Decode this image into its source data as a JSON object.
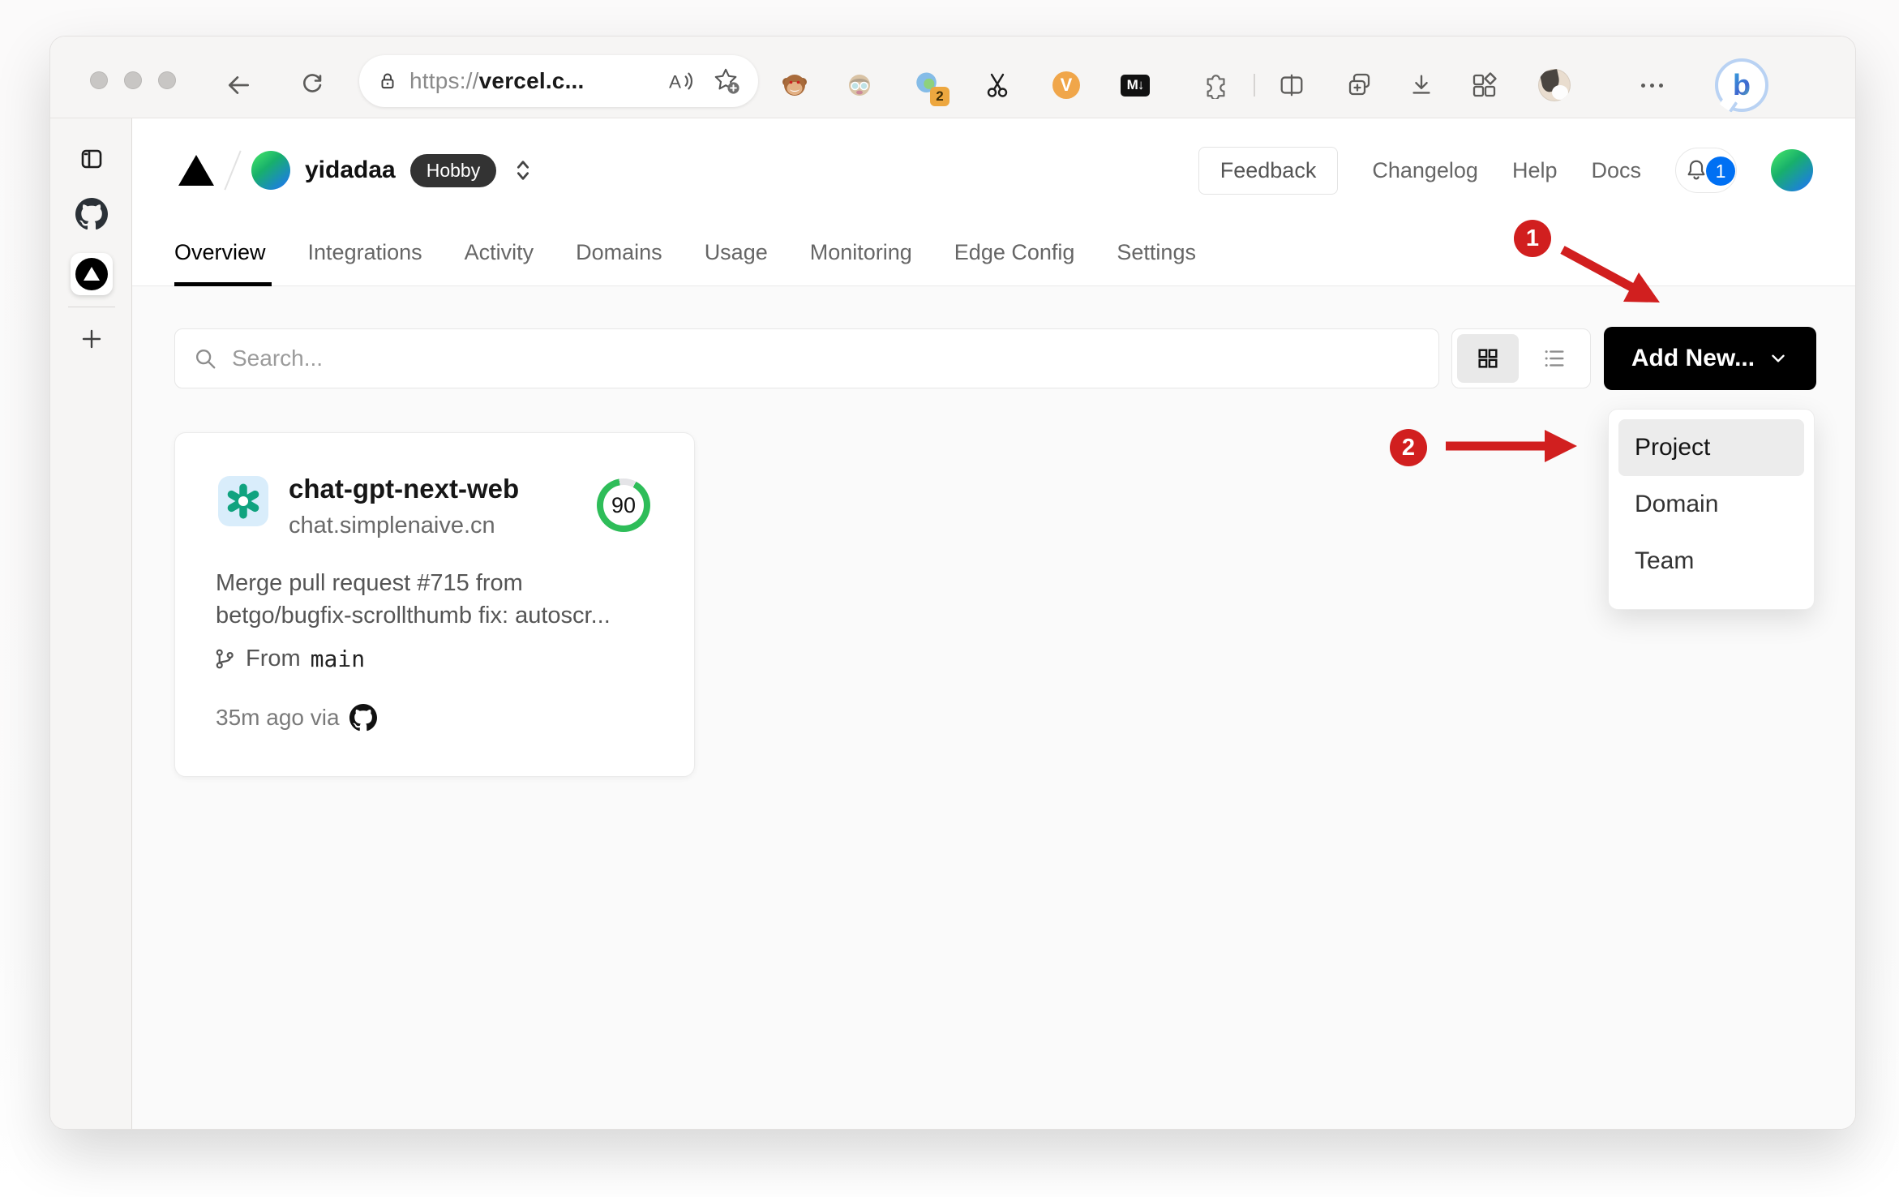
{
  "browser": {
    "url": {
      "scheme": "https://",
      "host": "vercel.c..."
    },
    "extensions_badge": "2",
    "markdown_glyph": "M↓",
    "video_glyph": "V",
    "copilot_glyph": "b"
  },
  "icons": {
    "search": "magnifier",
    "bell": "bell-outline",
    "github": "octocat-mark",
    "vercel": "black-triangle",
    "openai": "teal-knot",
    "branch": "git-branch",
    "grid_view": "2x2-grid",
    "list_view": "bullet-list",
    "add_new_chevron": "chevron-down",
    "team_switcher": "chevron-up-down"
  },
  "dashboard": {
    "team": {
      "name": "yidadaa",
      "plan": "Hobby"
    },
    "header_actions": {
      "feedback": "Feedback",
      "links": [
        "Changelog",
        "Help",
        "Docs"
      ],
      "notification_count": "1"
    },
    "tabs": [
      {
        "label": "Overview",
        "active": true
      },
      {
        "label": "Integrations",
        "active": false
      },
      {
        "label": "Activity",
        "active": false
      },
      {
        "label": "Domains",
        "active": false
      },
      {
        "label": "Usage",
        "active": false
      },
      {
        "label": "Monitoring",
        "active": false
      },
      {
        "label": "Edge Config",
        "active": false
      },
      {
        "label": "Settings",
        "active": false
      }
    ],
    "toolbar": {
      "search_placeholder": "Search...",
      "add_new_label": "Add New..."
    },
    "add_new_menu": {
      "items": [
        {
          "label": "Project",
          "highlighted": true
        },
        {
          "label": "Domain",
          "highlighted": false
        },
        {
          "label": "Team",
          "highlighted": false
        }
      ]
    },
    "project_card": {
      "name": "chat-gpt-next-web",
      "domain": "chat.simplenaive.cn",
      "score": "90",
      "commit_line1": "Merge pull request #715 from",
      "commit_line2": "betgo/bugfix-scrollthumb fix: autoscr...",
      "branch_label": "From",
      "branch_name": "main",
      "meta": "35m ago via"
    }
  },
  "annotations": {
    "step1_label": "1",
    "step2_label": "2"
  },
  "colors": {
    "annotation_red": "#d11f1f",
    "score_green": "#2ebd59",
    "notification_blue": "#0070f3",
    "button_black": "#000000",
    "content_bg": "#fafafa",
    "chrome_bg": "#f6f5f4"
  }
}
